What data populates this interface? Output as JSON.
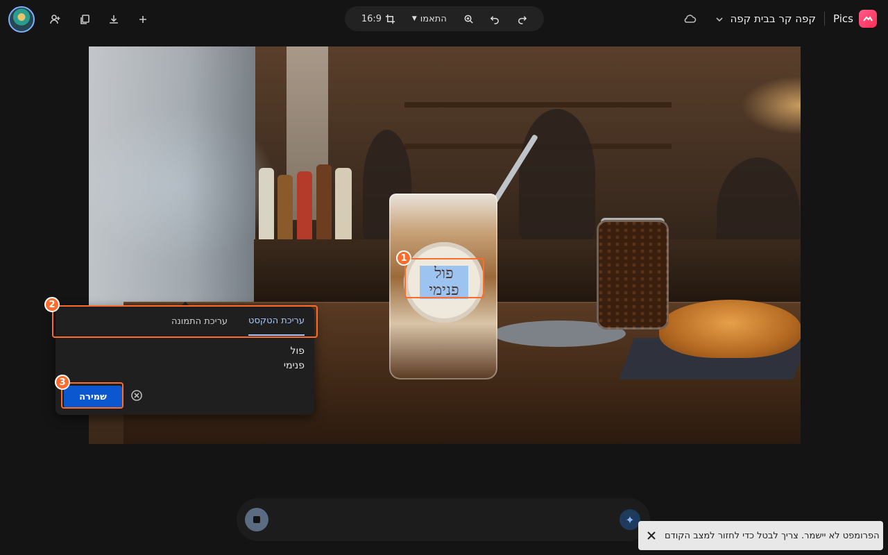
{
  "app": {
    "brand_name": "Pics",
    "doc_title": "קפה קר בבית קפה"
  },
  "toolbar": {
    "aspect_ratio": "16:9",
    "adjust_label": "התאמו",
    "icons": [
      "crop-icon",
      "zoom-icon",
      "undo-icon",
      "redo-icon"
    ]
  },
  "left_tools": [
    "avatar",
    "add-person-icon",
    "copy-icon",
    "download-icon",
    "plus-icon"
  ],
  "image": {
    "sticker_text_line1": "פול",
    "sticker_text_line2": "פנימי"
  },
  "edit_panel": {
    "tabs": [
      {
        "label": "עריכת הטקסט",
        "active": true
      },
      {
        "label": "עריכת התמונה",
        "active": false
      }
    ],
    "text_line1": "פול",
    "text_line2": "פנימי",
    "save_label": "שמירה"
  },
  "markers": [
    "1",
    "2",
    "3"
  ],
  "toast": {
    "message": "הפרומפט לא יישמר. צריך לבטל כדי לחזור למצב הקודם"
  },
  "colors": {
    "accent": "#0b57d0",
    "marker": "#ff6b2c",
    "tab_active": "#a8c7fa"
  }
}
